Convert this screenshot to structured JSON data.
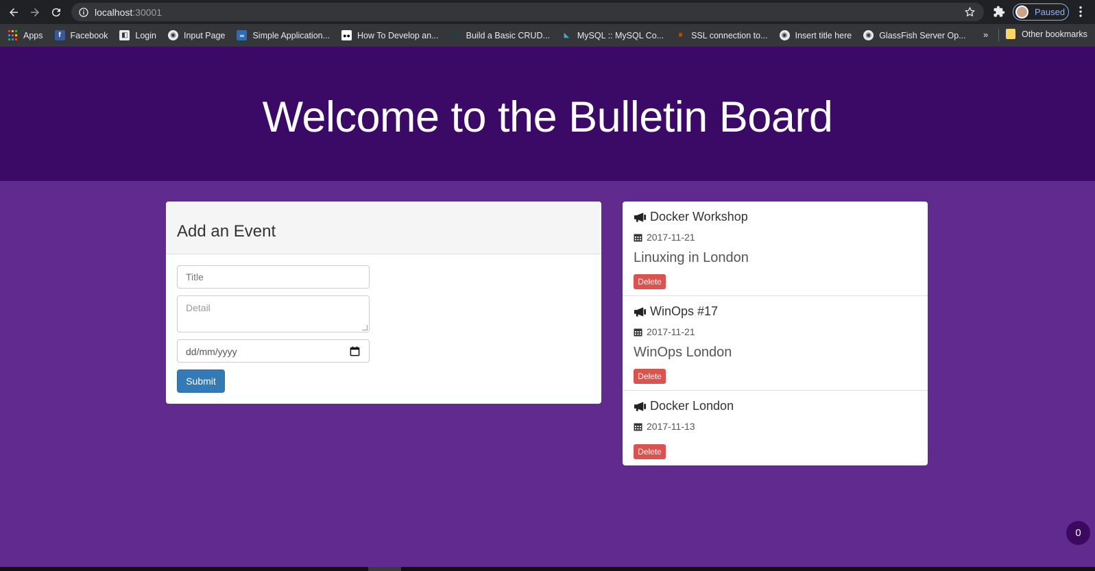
{
  "browser": {
    "url_host": "localhost",
    "url_port": ":30001",
    "profile_label": "Paused",
    "bookmarks": [
      {
        "label": "Apps",
        "icon": "apps-grid-icon"
      },
      {
        "label": "Facebook",
        "icon": "facebook-icon"
      },
      {
        "label": "Login",
        "icon": "login-page-icon"
      },
      {
        "label": "Input Page",
        "icon": "globe-icon"
      },
      {
        "label": "Simple Application...",
        "icon": "codeanywhere-icon"
      },
      {
        "label": "How To Develop an...",
        "icon": "medium-icon"
      },
      {
        "label": "Build a Basic CRUD...",
        "icon": "site-icon"
      },
      {
        "label": "MySQL :: MySQL Co...",
        "icon": "mysql-icon"
      },
      {
        "label": "SSL connection to...",
        "icon": "stackoverflow-icon"
      },
      {
        "label": "Insert title here",
        "icon": "globe-icon"
      },
      {
        "label": "GlassFish Server Op...",
        "icon": "globe-icon"
      }
    ],
    "more": "»",
    "other_bookmarks": "Other bookmarks"
  },
  "header": {
    "title": "Welcome to the Bulletin Board"
  },
  "form": {
    "heading": "Add an Event",
    "title_placeholder": "Title",
    "detail_placeholder": "Detail",
    "date_placeholder": "dd/mm/yyyy",
    "submit_label": "Submit"
  },
  "events": [
    {
      "title": "Docker Workshop",
      "date": "2017-11-21",
      "detail": "Linuxing in London",
      "delete_label": "Delete"
    },
    {
      "title": "WinOps #17",
      "date": "2017-11-21",
      "detail": "WinOps London",
      "delete_label": "Delete"
    },
    {
      "title": "Docker London",
      "date": "2017-11-13",
      "detail": "",
      "delete_label": "Delete"
    }
  ],
  "fab_count": "0",
  "colors": {
    "jumbotron": "#3b0a66",
    "page_background": "#612a8f",
    "submit": "#337ab7",
    "delete": "#d9534f"
  }
}
